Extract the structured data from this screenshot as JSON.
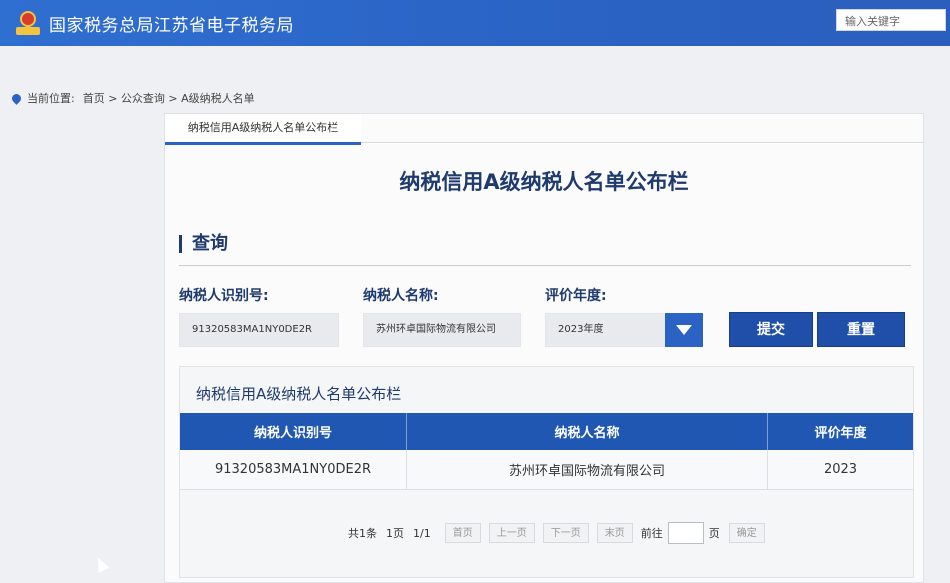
{
  "header": {
    "site_title": "国家税务总局江苏省电子税务局",
    "search_placeholder": "输入关键字"
  },
  "breadcrumb": {
    "label": "当前位置:",
    "path": "首页 > 公众查询 > A级纳税人名单"
  },
  "panel": {
    "tab_label": "纳税信用A级纳税人名单公布栏",
    "main_title": "纳税信用A级纳税人名单公布栏",
    "query_title": "查询"
  },
  "query": {
    "taxpayer_id_label": "纳税人识别号:",
    "taxpayer_id_value": "91320583MA1NY0DE2R",
    "taxpayer_name_label": "纳税人名称:",
    "taxpayer_name_value": "苏州环卓国际物流有限公司",
    "year_label": "评价年度:",
    "year_value": "2023年度",
    "submit_label": "提交",
    "reset_label": "重置"
  },
  "result": {
    "title": "纳税信用A级纳税人名单公布栏",
    "columns": [
      "纳税人识别号",
      "纳税人名称",
      "评价年度"
    ],
    "rows": [
      [
        "91320583MA1NY0DE2R",
        "苏州环卓国际物流有限公司",
        "2023"
      ]
    ]
  },
  "pager": {
    "total": "共1条",
    "pages": "1页",
    "current": "1/1",
    "first": "首页",
    "prev": "上一页",
    "next": "下一页",
    "last": "末页",
    "goto": "前往",
    "page_unit": "页",
    "confirm": "确定"
  },
  "colors": {
    "header_blue": "#2a63c4",
    "title_navy": "#1f3a6e",
    "button_blue": "#1f4fa8",
    "table_header_blue": "#1f57b3"
  }
}
